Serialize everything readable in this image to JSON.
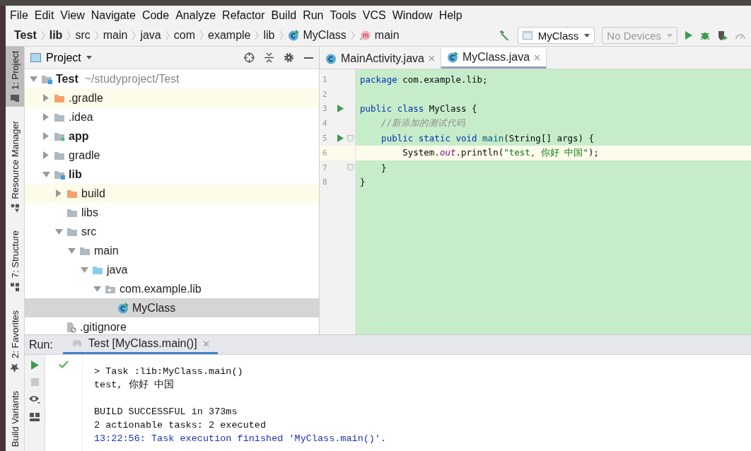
{
  "menu": [
    "File",
    "Edit",
    "View",
    "Navigate",
    "Code",
    "Analyze",
    "Refactor",
    "Build",
    "Run",
    "Tools",
    "VCS",
    "Window",
    "Help"
  ],
  "breadcrumbs": [
    {
      "label": "Test",
      "kind": "bold"
    },
    {
      "label": "lib",
      "kind": "bold"
    },
    {
      "label": "src",
      "kind": "plain"
    },
    {
      "label": "main",
      "kind": "plain"
    },
    {
      "label": "java",
      "kind": "plain"
    },
    {
      "label": "com",
      "kind": "plain"
    },
    {
      "label": "example",
      "kind": "plain"
    },
    {
      "label": "lib",
      "kind": "plain"
    },
    {
      "label": "MyClass",
      "kind": "class"
    },
    {
      "label": "main",
      "kind": "method"
    }
  ],
  "toolbar": {
    "configuration": "MyClass",
    "device": "No Devices",
    "device_disabled": true
  },
  "tool_tabs": [
    {
      "label": "1: Project",
      "kind": "project",
      "selected": true
    },
    {
      "label": "Resource Manager",
      "kind": "resources",
      "selected": false
    },
    {
      "label": "7: Structure",
      "kind": "structure",
      "selected": false
    },
    {
      "label": "2: Favorites",
      "kind": "favorites",
      "selected": false
    },
    {
      "label": "Build Variants",
      "kind": "variants",
      "selected": false
    }
  ],
  "project": {
    "title": "Project",
    "tree": [
      {
        "label": "Test",
        "path": "~/studyproject/Test",
        "kind": "module",
        "expanded": true,
        "selected": false,
        "children": [
          {
            "label": ".gradle",
            "kind": "excluded",
            "expanded": false,
            "selected": false
          },
          {
            "label": ".idea",
            "kind": "folder",
            "expanded": false,
            "selected": false
          },
          {
            "label": "app",
            "kind": "app",
            "expanded": false,
            "selected": false
          },
          {
            "label": "gradle",
            "kind": "folder",
            "expanded": false,
            "selected": false
          },
          {
            "label": "lib",
            "kind": "module",
            "expanded": true,
            "selected": false,
            "children": [
              {
                "label": "build",
                "kind": "excluded",
                "expanded": false,
                "selected": false
              },
              {
                "label": "libs",
                "kind": "folder",
                "selected": false
              },
              {
                "label": "src",
                "kind": "folder",
                "expanded": true,
                "selected": false,
                "children": [
                  {
                    "label": "main",
                    "kind": "folder",
                    "expanded": true,
                    "selected": false,
                    "children": [
                      {
                        "label": "java",
                        "kind": "source",
                        "expanded": true,
                        "selected": false,
                        "children": [
                          {
                            "label": "com.example.lib",
                            "kind": "package",
                            "expanded": true,
                            "selected": false,
                            "children": [
                              {
                                "label": "MyClass",
                                "kind": "class",
                                "selected": true
                              }
                            ]
                          }
                        ]
                      }
                    ]
                  }
                ]
              },
              {
                "label": ".gitignore",
                "kind": "file",
                "selected": false
              }
            ]
          }
        ]
      }
    ]
  },
  "editor": {
    "tabs": [
      {
        "label": "MainActivity.java",
        "kind": "class",
        "selected": false
      },
      {
        "label": "MyClass.java",
        "kind": "runnable",
        "selected": true
      }
    ],
    "lines": [
      {
        "number": "1",
        "run": false,
        "fold": false,
        "current": false,
        "tokens": [
          {
            "text": "package",
            "kind": "keyword"
          },
          {
            "text": " com.example.lib;",
            "kind": "plain"
          }
        ]
      },
      {
        "number": "2",
        "run": false,
        "fold": false,
        "current": false
      },
      {
        "number": "3",
        "run": true,
        "fold": false,
        "current": false,
        "tokens": [
          {
            "text": "public class",
            "kind": "keyword"
          },
          {
            "text": " MyClass {",
            "kind": "plain"
          }
        ]
      },
      {
        "number": "4",
        "run": false,
        "fold": false,
        "current": false,
        "tokens": [
          {
            "text": "    //新添加的测试代码",
            "kind": "comment"
          }
        ]
      },
      {
        "number": "5",
        "run": true,
        "fold": true,
        "current": false,
        "tokens": [
          {
            "text": "    public static void ",
            "kind": "keyword"
          },
          {
            "text": "main",
            "kind": "method"
          },
          {
            "text": "(String[] args) {",
            "kind": "plain"
          }
        ]
      },
      {
        "number": "6",
        "run": false,
        "fold": false,
        "current": true,
        "tokens": [
          {
            "text": "        System.",
            "kind": "plain"
          },
          {
            "text": "out",
            "kind": "field"
          },
          {
            "text": ".println(",
            "kind": "plain"
          },
          {
            "text": "\"test, 你好 中国\"",
            "kind": "string"
          },
          {
            "text": ");",
            "kind": "plain"
          }
        ]
      },
      {
        "number": "7",
        "run": false,
        "fold": true,
        "current": false,
        "tokens": [
          {
            "text": "    }",
            "kind": "plain"
          }
        ]
      },
      {
        "number": "8",
        "run": false,
        "fold": false,
        "current": false,
        "tokens": [
          {
            "text": "}",
            "kind": "plain"
          }
        ]
      }
    ]
  },
  "run": {
    "label": "Run:",
    "tab": {
      "label": "Test [MyClass.main()]",
      "selected": true
    },
    "succeeded": true,
    "console": [
      [
        {
          "text": "> Task :lib:MyClass.main()",
          "kind": "output"
        },
        {
          "text": "test, 你好 中国",
          "kind": "output"
        }
      ],
      [
        {
          "text": "BUILD SUCCESSFUL in 373ms",
          "kind": "output"
        },
        {
          "text": "2 actionable tasks: 2 executed",
          "kind": "output"
        },
        {
          "text": "13:22:56: Task execution finished 'MyClass.main()'.",
          "kind": "info"
        }
      ]
    ]
  }
}
